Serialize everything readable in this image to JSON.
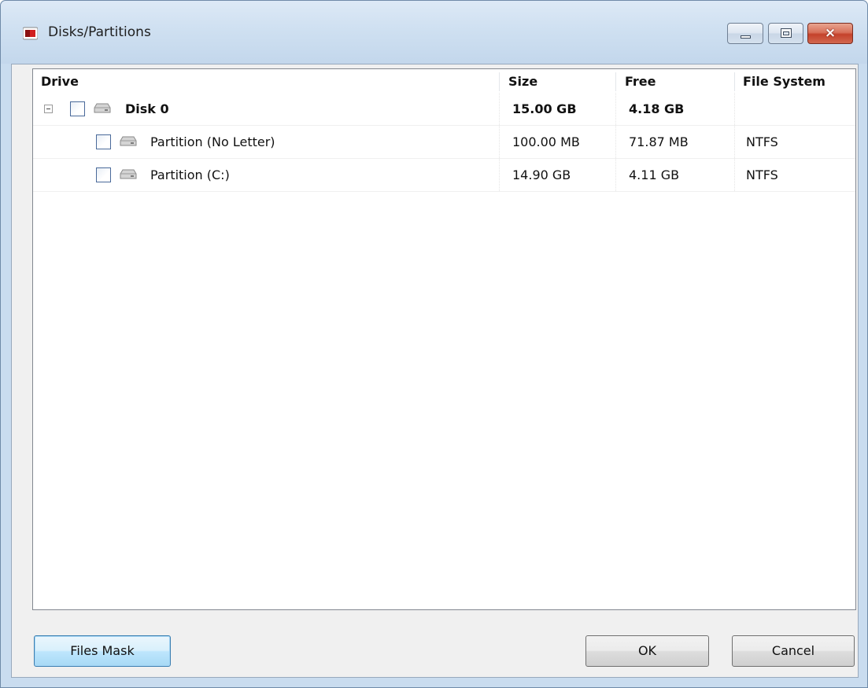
{
  "window": {
    "title": "Disks/Partitions",
    "accent_color": "#c4422b"
  },
  "title_buttons": {
    "minimize": "minimize",
    "maximize": "maximize",
    "close": "×"
  },
  "columns": {
    "drive": "Drive",
    "size": "Size",
    "free": "Free",
    "file_system": "File System"
  },
  "rows": [
    {
      "name": "Disk 0",
      "size": "15.00 GB",
      "free": "4.18 GB",
      "file_system": "",
      "checked": false,
      "expanded": true,
      "icon": "drive-icon"
    },
    {
      "name": "Partition (No Letter)",
      "size": "100.00 MB",
      "free": "71.87 MB",
      "file_system": "NTFS",
      "checked": false,
      "icon": "drive-icon"
    },
    {
      "name": "Partition (C:)",
      "size": "14.90 GB",
      "free": "4.11 GB",
      "file_system": "NTFS",
      "checked": false,
      "icon": "drive-icon"
    }
  ],
  "buttons": {
    "files_mask": "Files Mask",
    "ok": "OK",
    "cancel": "Cancel"
  }
}
